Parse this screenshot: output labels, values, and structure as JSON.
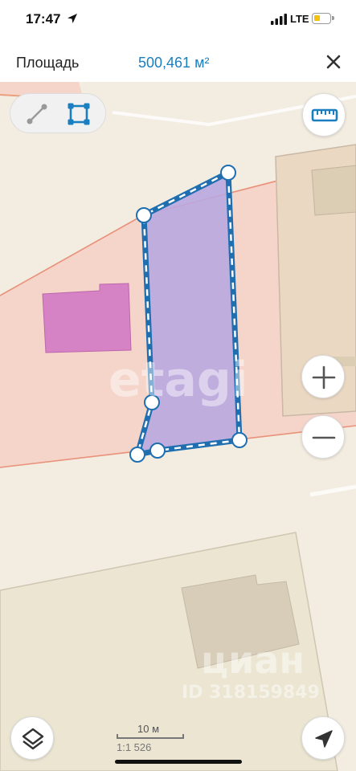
{
  "status": {
    "time": "17:47",
    "network": "LTE"
  },
  "header": {
    "label": "Площадь",
    "value": "500,461 м²"
  },
  "scale": {
    "distance": "10 м",
    "ratio": "1:1 526"
  },
  "watermarks": {
    "etagi": "etagi",
    "cian": "циан",
    "cian_id": "ID 318159849"
  },
  "icons": {
    "location": "location-arrow-icon",
    "close": "close-icon",
    "line_tool": "line-measure-icon",
    "area_tool": "area-measure-icon",
    "ruler": "ruler-icon",
    "zoom_in": "plus-icon",
    "zoom_out": "minus-icon",
    "layers": "layers-icon",
    "my_location": "navigation-arrow-icon"
  },
  "colors": {
    "accent": "#1a7fc1",
    "polygon_fill": "#b9a8e0",
    "polygon_stroke": "#1f6fb0",
    "building": "#d683c5"
  }
}
